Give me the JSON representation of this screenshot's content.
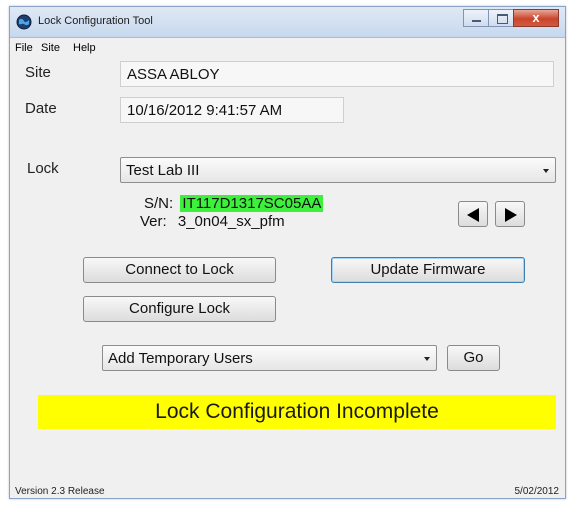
{
  "window": {
    "title": "Lock Configuration Tool",
    "close_glyph": "x"
  },
  "menu": {
    "items": [
      "File",
      "Site",
      "Help"
    ]
  },
  "site": {
    "label": "Site",
    "value": "ASSA ABLOY"
  },
  "date": {
    "label": "Date",
    "value": "10/16/2012 9:41:57 AM"
  },
  "lock": {
    "label": "Lock",
    "selected": "Test Lab III",
    "sn_label": "S/N:",
    "sn_value": "IT117D1317SC05AA",
    "ver_label": "Ver:",
    "ver_value": "3_0n04_sx_pfm",
    "highlight_color": "#3cf03c"
  },
  "buttons": {
    "connect": "Connect to Lock",
    "update_firmware": "Update Firmware",
    "configure": "Configure Lock",
    "go": "Go"
  },
  "action_select": {
    "selected": "Add Temporary Users"
  },
  "status": {
    "text": "Lock Configuration Incomplete",
    "color": "#ffff00"
  },
  "footer": {
    "version": "Version 2.3 Release",
    "date": "5/02/2012"
  }
}
